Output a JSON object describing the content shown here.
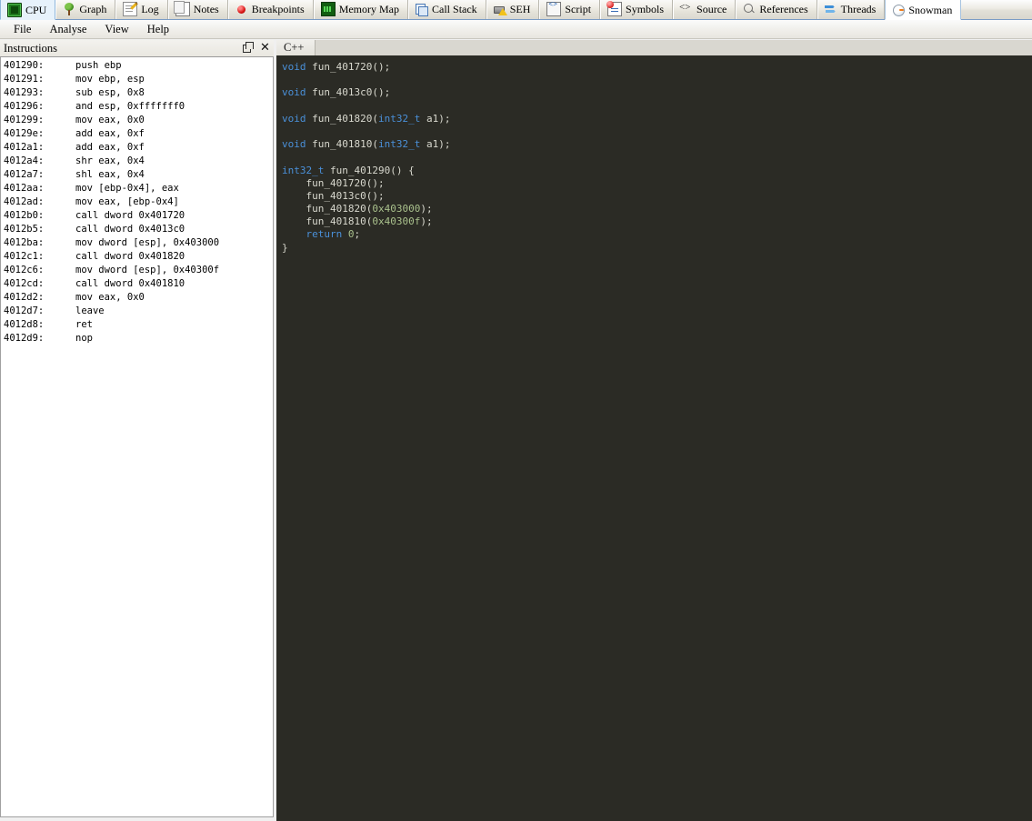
{
  "tabs": [
    {
      "label": "CPU",
      "icon": "cpu-icon",
      "active": true
    },
    {
      "label": "Graph",
      "icon": "tree-icon",
      "active": false
    },
    {
      "label": "Log",
      "icon": "log-page-icon",
      "active": false
    },
    {
      "label": "Notes",
      "icon": "notes-icon",
      "active": false
    },
    {
      "label": "Breakpoints",
      "icon": "red-dot-icon",
      "active": false
    },
    {
      "label": "Memory Map",
      "icon": "memory-chip-icon",
      "active": false
    },
    {
      "label": "Call Stack",
      "icon": "stack-icon",
      "active": false
    },
    {
      "label": "SEH",
      "icon": "seh-warning-icon",
      "active": false
    },
    {
      "label": "Script",
      "icon": "script-icon",
      "active": false
    },
    {
      "label": "Symbols",
      "icon": "symbols-icon",
      "active": false
    },
    {
      "label": "Source",
      "icon": "angle-brackets-icon",
      "active": false
    },
    {
      "label": "References",
      "icon": "magnifier-icon",
      "active": false
    },
    {
      "label": "Threads",
      "icon": "threads-arrows-icon",
      "active": false
    },
    {
      "label": "Snowman",
      "icon": "snowman-icon",
      "active": true
    }
  ],
  "menubar": {
    "items": [
      "File",
      "Analyse",
      "View",
      "Help"
    ]
  },
  "left_panel": {
    "title": "Instructions",
    "float_button": "float-restore-icon",
    "close_button": "✕",
    "instructions": [
      {
        "address": "401290:",
        "text": "push ebp"
      },
      {
        "address": "401291:",
        "text": "mov ebp, esp"
      },
      {
        "address": "401293:",
        "text": "sub esp, 0x8"
      },
      {
        "address": "401296:",
        "text": "and esp, 0xfffffff0"
      },
      {
        "address": "401299:",
        "text": "mov eax, 0x0"
      },
      {
        "address": "40129e:",
        "text": "add eax, 0xf"
      },
      {
        "address": "4012a1:",
        "text": "add eax, 0xf"
      },
      {
        "address": "4012a4:",
        "text": "shr eax, 0x4"
      },
      {
        "address": "4012a7:",
        "text": "shl eax, 0x4"
      },
      {
        "address": "4012aa:",
        "text": "mov [ebp-0x4], eax"
      },
      {
        "address": "4012ad:",
        "text": "mov eax, [ebp-0x4]"
      },
      {
        "address": "4012b0:",
        "text": "call dword 0x401720"
      },
      {
        "address": "4012b5:",
        "text": "call dword 0x4013c0"
      },
      {
        "address": "4012ba:",
        "text": "mov dword [esp], 0x403000"
      },
      {
        "address": "4012c1:",
        "text": "call dword 0x401820"
      },
      {
        "address": "4012c6:",
        "text": "mov dword [esp], 0x40300f"
      },
      {
        "address": "4012cd:",
        "text": "call dword 0x401810"
      },
      {
        "address": "4012d2:",
        "text": "mov eax, 0x0"
      },
      {
        "address": "4012d7:",
        "text": "leave"
      },
      {
        "address": "4012d8:",
        "text": "ret"
      },
      {
        "address": "4012d9:",
        "text": "nop"
      }
    ]
  },
  "right_panel": {
    "tab_label": "C++",
    "code_lines": [
      [
        {
          "t": "void ",
          "c": "kw"
        },
        {
          "t": "fun_401720();",
          "c": "id"
        }
      ],
      [],
      [
        {
          "t": "void ",
          "c": "kw"
        },
        {
          "t": "fun_4013c0();",
          "c": "id"
        }
      ],
      [],
      [
        {
          "t": "void ",
          "c": "kw"
        },
        {
          "t": "fun_401820(",
          "c": "id"
        },
        {
          "t": "int32_t ",
          "c": "kw"
        },
        {
          "t": "a1);",
          "c": "id"
        }
      ],
      [],
      [
        {
          "t": "void ",
          "c": "kw"
        },
        {
          "t": "fun_401810(",
          "c": "id"
        },
        {
          "t": "int32_t ",
          "c": "kw"
        },
        {
          "t": "a1);",
          "c": "id"
        }
      ],
      [],
      [
        {
          "t": "int32_t ",
          "c": "kw"
        },
        {
          "t": "fun_401290() {",
          "c": "id"
        }
      ],
      [
        {
          "t": "    fun_401720();",
          "c": "id"
        }
      ],
      [
        {
          "t": "    fun_4013c0();",
          "c": "id"
        }
      ],
      [
        {
          "t": "    fun_401820(",
          "c": "id"
        },
        {
          "t": "0x403000",
          "c": "num"
        },
        {
          "t": ");",
          "c": "id"
        }
      ],
      [
        {
          "t": "    fun_401810(",
          "c": "id"
        },
        {
          "t": "0x40300f",
          "c": "num"
        },
        {
          "t": ");",
          "c": "id"
        }
      ],
      [
        {
          "t": "    ",
          "c": "id"
        },
        {
          "t": "return ",
          "c": "kw"
        },
        {
          "t": "0",
          "c": "num"
        },
        {
          "t": ";",
          "c": "id"
        }
      ],
      [
        {
          "t": "}",
          "c": "punc"
        }
      ]
    ]
  },
  "colors": {
    "code_background": "#2b2b25",
    "keyword": "#4a90d9",
    "number": "#a9c08c",
    "identifier": "#d8d8ce",
    "panel_background": "#ffffff",
    "chrome_background": "#e8e6df"
  }
}
